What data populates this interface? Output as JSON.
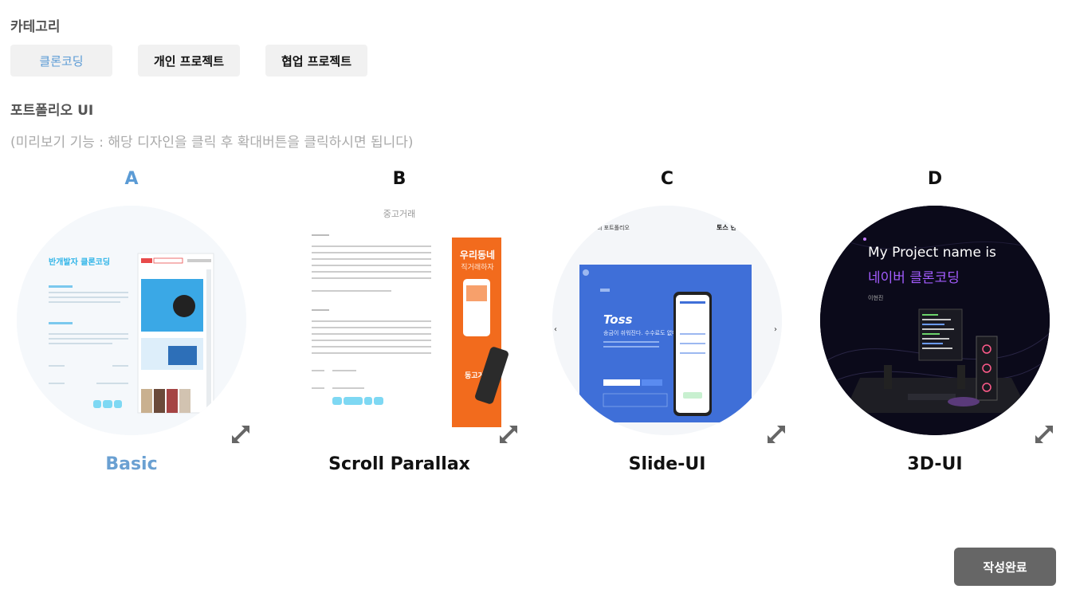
{
  "category": {
    "title": "카테고리",
    "buttons": [
      {
        "label": "클론코딩",
        "active": true
      },
      {
        "label": "개인 프로젝트",
        "active": false
      },
      {
        "label": "협업 프로젝트",
        "active": false
      }
    ]
  },
  "portfolio": {
    "title": "포트폴리오 UI",
    "hint": "(미리보기 기능 : 해당 디자인을 클릭 후 확대버튼을 클릭하시면 됩니다)"
  },
  "cards": [
    {
      "letter": "A",
      "name": "Basic",
      "active": true,
      "thumb": {
        "heading": "반개발자 클론코딩"
      }
    },
    {
      "letter": "B",
      "name": "Scroll Parallax",
      "active": false,
      "thumb": {
        "heading": "중고거래",
        "banner_top": "우리동네",
        "banner_sub": "직거래하자",
        "banner_bottom": "동고거래 앱"
      }
    },
    {
      "letter": "C",
      "name": "Slide-UI",
      "active": false,
      "thumb": {
        "top_left": "의 포트폴리오",
        "top_right": "토스 한",
        "brand": "Toss",
        "tagline": "송금이 쉬워진다. 수수료도 없다."
      }
    },
    {
      "letter": "D",
      "name": "3D-UI",
      "active": false,
      "thumb": {
        "line1": "My Project name is",
        "line2": "네이버 클론코딩",
        "author": "이현진"
      }
    }
  ],
  "submit": {
    "label": "작성완료"
  },
  "colors": {
    "accent": "#5b9bd5",
    "button_bg": "#f1f1f1",
    "submit_bg": "#666666",
    "toss_blue": "#3f6fd8",
    "orange": "#f26b1d",
    "purple": "#a35cff"
  },
  "icons": {
    "expand": "expand-arrows-icon"
  }
}
